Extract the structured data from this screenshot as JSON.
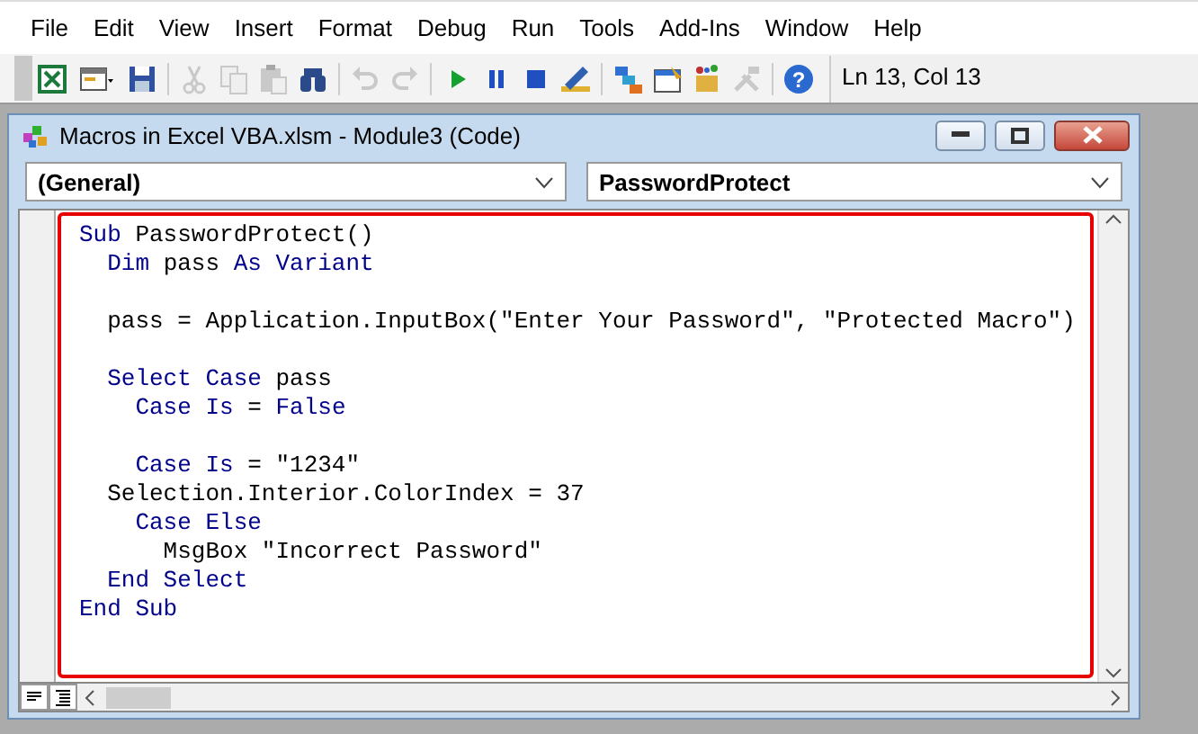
{
  "menu": [
    {
      "label": "File"
    },
    {
      "label": "Edit"
    },
    {
      "label": "View"
    },
    {
      "label": "Insert"
    },
    {
      "label": "Format"
    },
    {
      "label": "Debug"
    },
    {
      "label": "Run"
    },
    {
      "label": "Tools"
    },
    {
      "label": "Add-Ins"
    },
    {
      "label": "Window"
    },
    {
      "label": "Help"
    }
  ],
  "toolbar": {
    "buttons": [
      {
        "kind": "excel",
        "disabled": false
      },
      {
        "kind": "insert",
        "disabled": false
      },
      {
        "kind": "save",
        "disabled": false
      },
      {
        "kind": "cut",
        "disabled": true
      },
      {
        "kind": "copy",
        "disabled": true
      },
      {
        "kind": "paste",
        "disabled": true
      },
      {
        "kind": "find",
        "disabled": false
      },
      {
        "kind": "undo",
        "disabled": true
      },
      {
        "kind": "redo",
        "disabled": true
      },
      {
        "kind": "run",
        "disabled": false
      },
      {
        "kind": "pause",
        "disabled": false
      },
      {
        "kind": "stop",
        "disabled": false
      },
      {
        "kind": "design",
        "disabled": false
      },
      {
        "kind": "project",
        "disabled": false
      },
      {
        "kind": "properties",
        "disabled": false
      },
      {
        "kind": "browser",
        "disabled": false
      },
      {
        "kind": "toolbox",
        "disabled": true
      },
      {
        "kind": "help",
        "disabled": false,
        "glyph": "?"
      }
    ],
    "position": "Ln 13, Col 13"
  },
  "window": {
    "title": "Macros in Excel VBA.xlsm - Module3 (Code)",
    "object_dropdown": "(General)",
    "procedure_dropdown": "PasswordProtect",
    "code_lines": [
      {
        "kind": "code",
        "segments": [
          {
            "kind": "keyword",
            "text": "Sub"
          },
          {
            "kind": "plain",
            "text": " PasswordProtect()"
          }
        ]
      },
      {
        "kind": "code",
        "segments": [
          {
            "kind": "keyword",
            "text": "  Dim"
          },
          {
            "kind": "plain",
            "text": " pass "
          },
          {
            "kind": "keyword",
            "text": "As Variant"
          }
        ]
      },
      {
        "kind": "blank"
      },
      {
        "kind": "code",
        "segments": [
          {
            "kind": "plain",
            "text": "  pass = Application.InputBox(\"Enter Your Password\", \"Protected Macro\")"
          }
        ]
      },
      {
        "kind": "blank"
      },
      {
        "kind": "code",
        "segments": [
          {
            "kind": "keyword",
            "text": "  Select Case"
          },
          {
            "kind": "plain",
            "text": " pass"
          }
        ]
      },
      {
        "kind": "code",
        "segments": [
          {
            "kind": "keyword",
            "text": "    Case Is"
          },
          {
            "kind": "plain",
            "text": " = "
          },
          {
            "kind": "keyword",
            "text": "False"
          }
        ]
      },
      {
        "kind": "blank"
      },
      {
        "kind": "code",
        "segments": [
          {
            "kind": "keyword",
            "text": "    Case Is"
          },
          {
            "kind": "plain",
            "text": " = \"1234\""
          }
        ]
      },
      {
        "kind": "code",
        "segments": [
          {
            "kind": "plain",
            "text": "  Selection.Interior.ColorIndex = 37"
          }
        ]
      },
      {
        "kind": "code",
        "segments": [
          {
            "kind": "keyword",
            "text": "    Case Else"
          }
        ]
      },
      {
        "kind": "code",
        "segments": [
          {
            "kind": "plain",
            "text": "      MsgBox \"Incorrect Password\""
          }
        ]
      },
      {
        "kind": "code",
        "segments": [
          {
            "kind": "keyword",
            "text": "  End Select"
          }
        ]
      },
      {
        "kind": "code",
        "segments": [
          {
            "kind": "keyword",
            "text": "End Sub"
          }
        ]
      }
    ]
  }
}
